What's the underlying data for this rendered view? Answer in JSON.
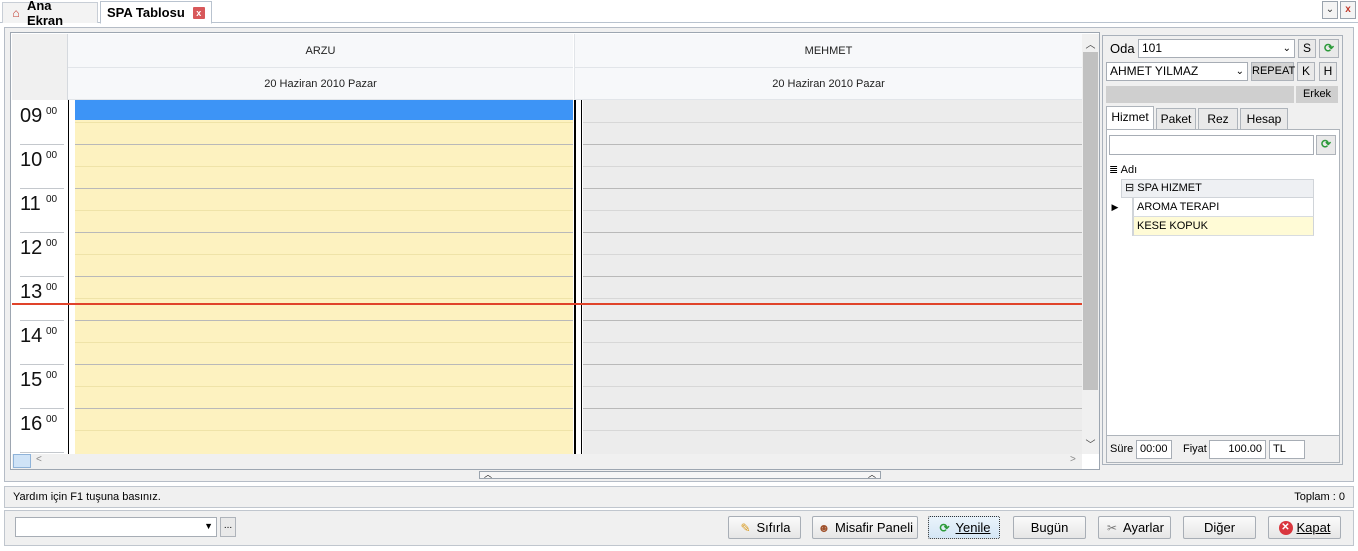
{
  "tabs": {
    "home_label": "Ana Ekran",
    "spa_label": "SPA Tablosu",
    "close_glyph": "x"
  },
  "window": {
    "dropdown_glyph": "⌄",
    "close_glyph": "x"
  },
  "scheduler": {
    "columns": [
      {
        "name": "ARZU",
        "date": "20 Haziran 2010 Pazar"
      },
      {
        "name": "MEHMET",
        "date": "20 Haziran 2010 Pazar"
      }
    ],
    "hours": [
      {
        "h": "09",
        "m": "00"
      },
      {
        "h": "10",
        "m": "00"
      },
      {
        "h": "11",
        "m": "00"
      },
      {
        "h": "12",
        "m": "00"
      },
      {
        "h": "13",
        "m": "00"
      },
      {
        "h": "14",
        "m": "00"
      },
      {
        "h": "15",
        "m": "00"
      },
      {
        "h": "16",
        "m": "00"
      }
    ],
    "colors": {
      "arzu_bg": "#fdf2c0",
      "mehmet_bg": "#ececec",
      "selected": "#3d94f6",
      "current_time_line": "#e0432a"
    }
  },
  "side": {
    "room_label": "Oda",
    "room_value": "101",
    "s_button": "S",
    "guest_value": "AHMET YILMAZ",
    "repeat_label": "REPEAT",
    "k_button": "K",
    "h_button": "H",
    "gender_label": "Erkek",
    "tabs": [
      "Hizmet",
      "Paket",
      "Rez",
      "Hesap"
    ],
    "grid_header": "Adı",
    "group_label": "SPA HIZMET",
    "rows": [
      "AROMA TERAPI",
      "KESE KOPUK"
    ],
    "duration_label": "Süre",
    "duration_value": "00:00",
    "price_label": "Fiyat",
    "price_value": "100.00",
    "currency_value": "TL"
  },
  "status": {
    "help_text": "Yardım için F1 tuşuna basınız.",
    "total_text": "Toplam : 0"
  },
  "buttons": {
    "reset": "Sıfırla",
    "guest_panel": "Misafir Paneli",
    "refresh": "Yenile",
    "today": "Bugün",
    "settings": "Ayarlar",
    "other": "Diğer",
    "close": "Kapat",
    "ellipsis": "..."
  }
}
